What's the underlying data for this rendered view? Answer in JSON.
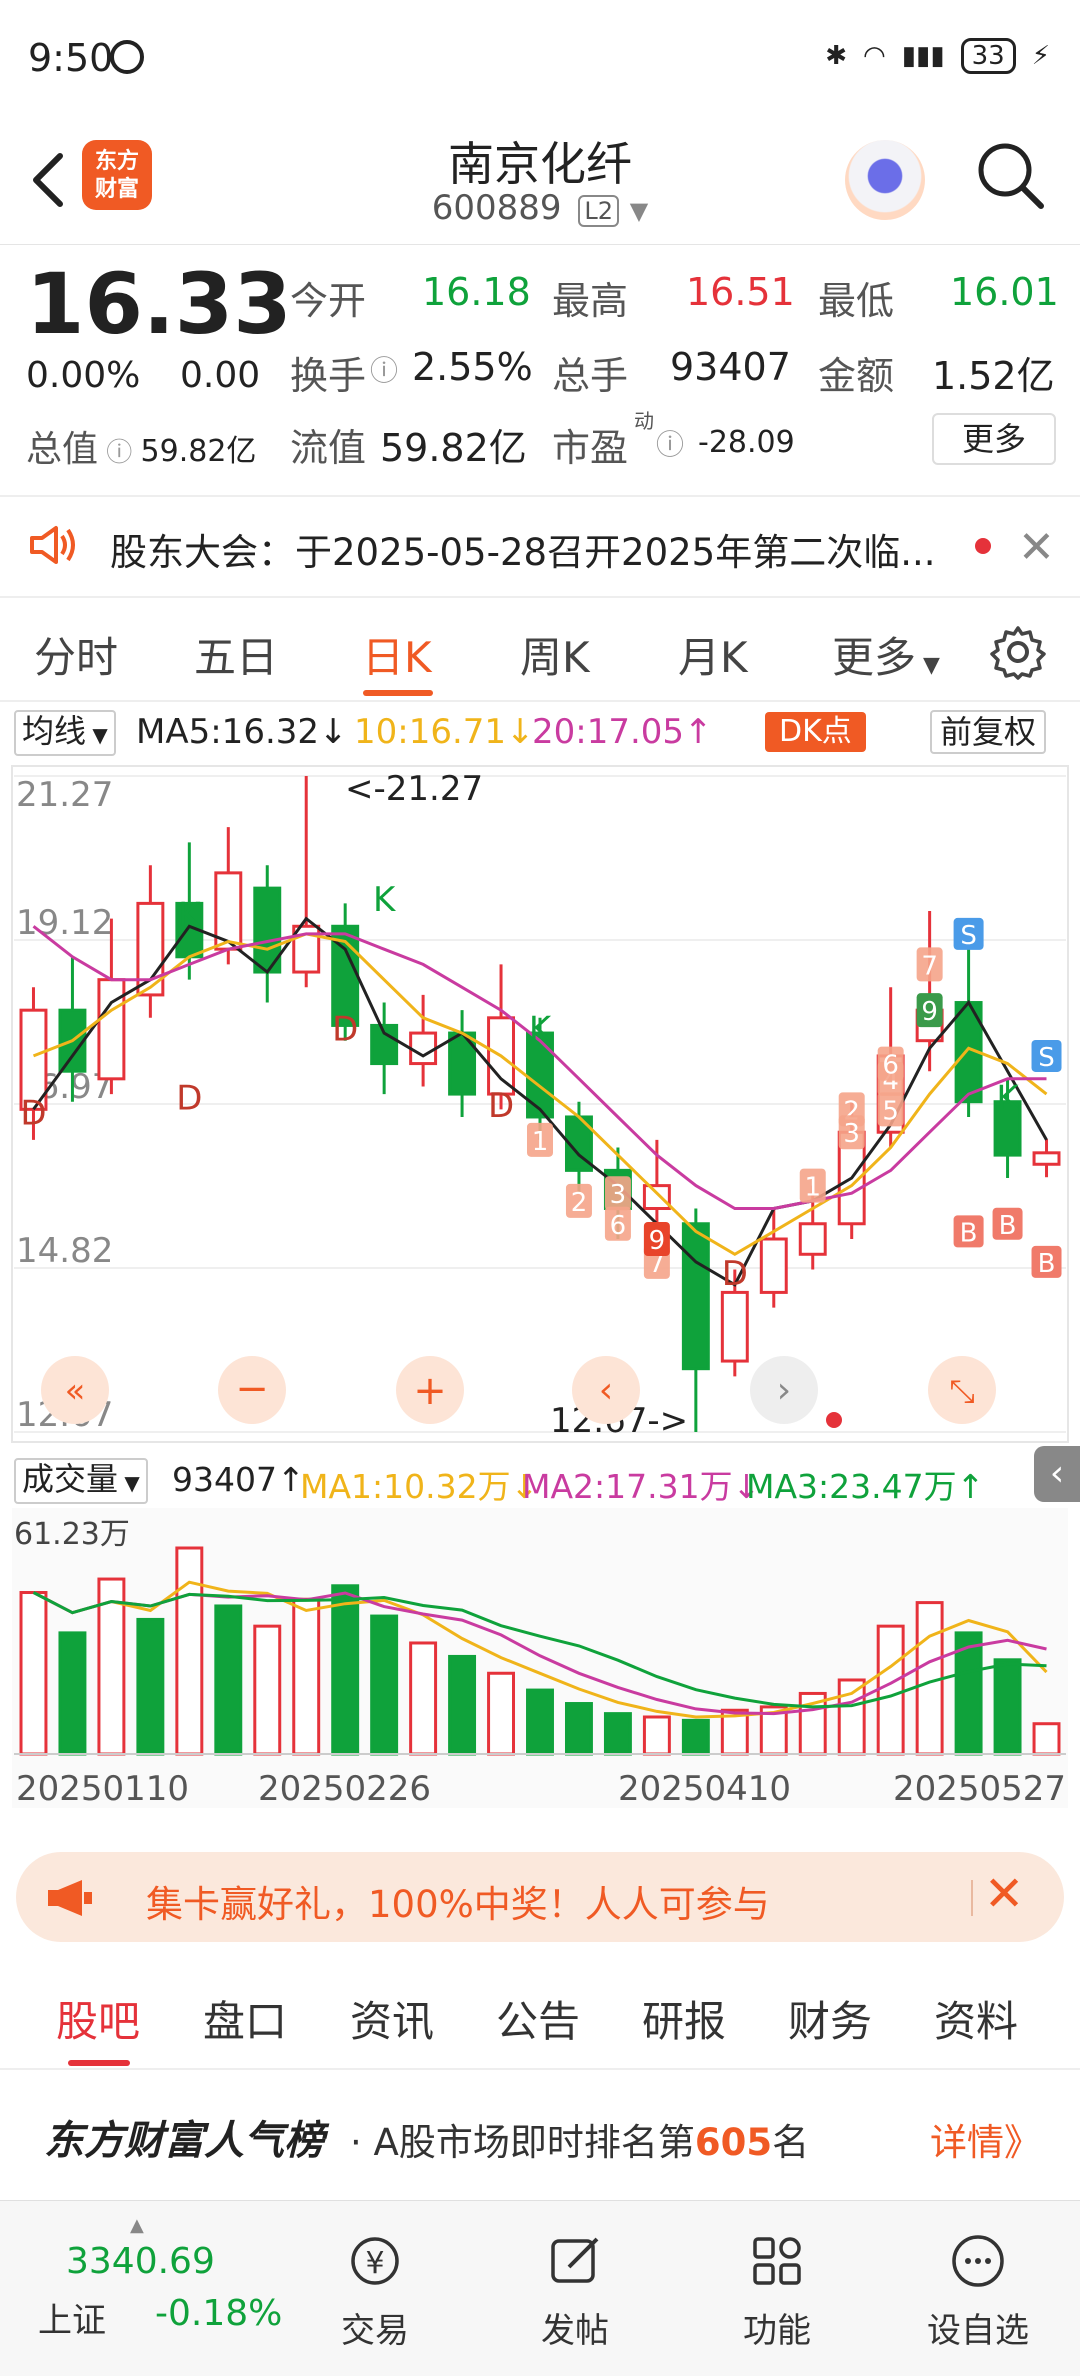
{
  "status_bar": {
    "time": "9:50",
    "battery": "33"
  },
  "header": {
    "stock_name": "南京化纤",
    "stock_code": "600889",
    "level": "L2",
    "logo_text": "东方财富"
  },
  "quote": {
    "price": "16.33",
    "change_pct": "0.00%",
    "change_amt": "0.00",
    "total_value_label": "总值",
    "total_value": "59.82亿",
    "open_label": "今开",
    "open": "16.18",
    "high_label": "最高",
    "high": "16.51",
    "low_label": "最低",
    "low": "16.01",
    "turnover_label": "换手",
    "turnover": "2.55%",
    "volume_label": "总手",
    "volume": "93407",
    "amount_label": "金额",
    "amount": "1.52亿",
    "float_label": "流值",
    "float_value": "59.82亿",
    "pe_label": "市盈",
    "pe_sup": "动",
    "pe": "-28.09",
    "more_label": "更多"
  },
  "notice": {
    "text": "股东大会：于2025-05-28召开2025年第二次临..."
  },
  "period_tabs": [
    "分时",
    "五日",
    "日K",
    "周K",
    "月K",
    "更多"
  ],
  "period_active": "日K",
  "ma_legend": {
    "select": "均线",
    "ma5": "MA5:16.32↓",
    "ma10": "10:16.71↓",
    "ma20": "20:17.05↑",
    "dk_button": "DK点",
    "adjust_button": "前复权"
  },
  "colors": {
    "up": "#e5323a",
    "down": "#0fa23b",
    "accent": "#f05a24",
    "ma5": "#222222",
    "ma10": "#f0b41a",
    "ma20": "#c93ba0"
  },
  "chart_data": {
    "type": "candlestick",
    "y_ticks": [
      "21.27",
      "19.12",
      "16.97",
      "14.82",
      "12.67"
    ],
    "ylim": [
      12.67,
      21.27
    ],
    "max_label": "<-21.27",
    "min_label": "12.67->",
    "x_ticks": [
      "20250110",
      "20250226",
      "20250410",
      "20250527"
    ],
    "series": [
      {
        "name": "MA5",
        "values": [
          16.9,
          17.6,
          18.3,
          18.6,
          19.3,
          19.1,
          18.7,
          19.4,
          19.0,
          17.9,
          17.6,
          17.9,
          17.3,
          16.9,
          16.3,
          15.9,
          15.4,
          14.9,
          14.6,
          15.6,
          15.7,
          16.0,
          16.7,
          17.7,
          18.3,
          17.4,
          16.5
        ]
      },
      {
        "name": "MA10",
        "values": [
          17.6,
          17.8,
          18.2,
          18.5,
          18.9,
          19.1,
          19.0,
          19.2,
          19.1,
          18.6,
          18.1,
          17.9,
          17.6,
          17.2,
          16.8,
          16.3,
          15.8,
          15.3,
          15.0,
          15.3,
          15.6,
          15.9,
          16.4,
          17.1,
          17.7,
          17.5,
          17.1
        ]
      },
      {
        "name": "MA20",
        "values": [
          19.3,
          18.9,
          18.6,
          18.6,
          18.8,
          19.0,
          19.1,
          19.2,
          19.2,
          19.0,
          18.8,
          18.5,
          18.2,
          17.8,
          17.3,
          16.8,
          16.3,
          15.9,
          15.6,
          15.6,
          15.7,
          15.8,
          16.1,
          16.6,
          17.1,
          17.3,
          17.3
        ]
      }
    ],
    "candles": [
      {
        "o": 16.9,
        "c": 18.2,
        "h": 18.5,
        "l": 16.5
      },
      {
        "o": 18.2,
        "c": 17.4,
        "h": 18.9,
        "l": 17.0
      },
      {
        "o": 17.3,
        "c": 18.6,
        "h": 19.4,
        "l": 17.1
      },
      {
        "o": 18.4,
        "c": 19.6,
        "h": 20.1,
        "l": 18.1
      },
      {
        "o": 19.6,
        "c": 18.9,
        "h": 20.4,
        "l": 18.6
      },
      {
        "o": 19.0,
        "c": 20.0,
        "h": 20.6,
        "l": 18.8
      },
      {
        "o": 19.8,
        "c": 18.7,
        "h": 20.1,
        "l": 18.3
      },
      {
        "o": 18.7,
        "c": 19.3,
        "h": 21.27,
        "l": 18.5
      },
      {
        "o": 19.3,
        "c": 18.0,
        "h": 19.6,
        "l": 17.8
      },
      {
        "o": 18.0,
        "c": 17.5,
        "h": 18.3,
        "l": 17.1
      },
      {
        "o": 17.5,
        "c": 17.9,
        "h": 18.4,
        "l": 17.2
      },
      {
        "o": 17.9,
        "c": 17.1,
        "h": 18.2,
        "l": 16.8
      },
      {
        "o": 17.1,
        "c": 18.1,
        "h": 18.8,
        "l": 16.9
      },
      {
        "o": 17.9,
        "c": 16.8,
        "h": 18.1,
        "l": 16.5
      },
      {
        "o": 16.8,
        "c": 16.1,
        "h": 17.0,
        "l": 15.8
      },
      {
        "o": 16.1,
        "c": 15.6,
        "h": 16.4,
        "l": 15.2
      },
      {
        "o": 15.6,
        "c": 15.9,
        "h": 16.5,
        "l": 15.0
      },
      {
        "o": 15.4,
        "c": 13.5,
        "h": 15.6,
        "l": 12.67
      },
      {
        "o": 13.6,
        "c": 14.5,
        "h": 14.8,
        "l": 13.4
      },
      {
        "o": 14.5,
        "c": 15.2,
        "h": 15.6,
        "l": 14.3
      },
      {
        "o": 15.0,
        "c": 15.4,
        "h": 15.9,
        "l": 14.8
      },
      {
        "o": 15.4,
        "c": 16.6,
        "h": 17.0,
        "l": 15.2
      },
      {
        "o": 16.6,
        "c": 17.6,
        "h": 18.5,
        "l": 16.4
      },
      {
        "o": 17.8,
        "c": 18.2,
        "h": 19.5,
        "l": 17.4
      },
      {
        "o": 18.3,
        "c": 17.0,
        "h": 19.2,
        "l": 16.8
      },
      {
        "o": 17.0,
        "c": 16.3,
        "h": 17.3,
        "l": 16.0
      },
      {
        "o": 16.18,
        "c": 16.33,
        "h": 16.51,
        "l": 16.01
      }
    ],
    "markers": [
      "K",
      "D",
      "S",
      "B",
      "1",
      "2",
      "3",
      "4",
      "5",
      "6",
      "7",
      "9"
    ]
  },
  "volume_legend": {
    "select": "成交量",
    "vol": "93407↑",
    "ma1": "MA1:10.32万↓",
    "ma2": "MA2:17.31万↓",
    "ma3": "MA3:23.47万↑",
    "max_label": "61.23万"
  },
  "volume_data": {
    "values": [
      48,
      36,
      52,
      40,
      61.23,
      44,
      38,
      46,
      50,
      41,
      33,
      29,
      24,
      19,
      15,
      12,
      11,
      10,
      13,
      14,
      18,
      22,
      38,
      45,
      36,
      28,
      9
    ],
    "up": [
      true,
      false,
      true,
      false,
      true,
      false,
      true,
      true,
      false,
      false,
      true,
      false,
      true,
      false,
      false,
      false,
      true,
      false,
      true,
      true,
      true,
      true,
      true,
      true,
      false,
      false,
      true
    ]
  },
  "promo": {
    "text": "集卡赢好礼，100%中奖！人人可参与"
  },
  "bottom_tabs": [
    "股吧",
    "盘口",
    "资讯",
    "公告",
    "研报",
    "财务",
    "资料"
  ],
  "bottom_active": "股吧",
  "rank": {
    "brand": "东方财富人气榜",
    "desc_prefix": "A股市场即时排名第",
    "rank_num": "605",
    "desc_suffix": "名",
    "detail": "详情》"
  },
  "bottom_bar": {
    "index_value": "3340.69",
    "index_name": "上证",
    "index_change": "-0.18%",
    "items": [
      "交易",
      "发帖",
      "功能",
      "设自选"
    ]
  }
}
